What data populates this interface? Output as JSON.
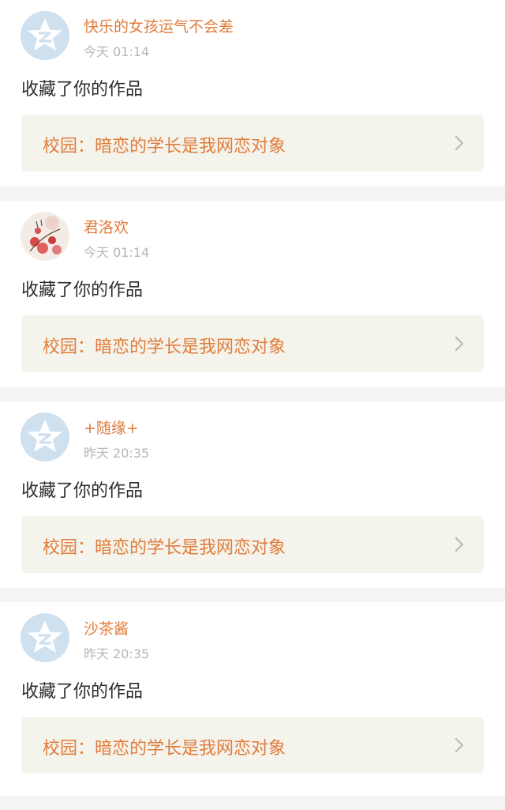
{
  "feed": {
    "items": [
      {
        "user": "快乐的女孩运气不会差",
        "time": "今天 01:14",
        "action": "收藏了你的作品",
        "work_title": "校园：暗恋的学长是我网恋对象",
        "avatar_icon": "default-qzone-star-icon"
      },
      {
        "user": "君洛欢",
        "time": "今天 01:14",
        "action": "收藏了你的作品",
        "work_title": "校园：暗恋的学长是我网恋对象",
        "avatar_icon": "photo-avatar"
      },
      {
        "user": "+随缘+",
        "time": "昨天 20:35",
        "action": "收藏了你的作品",
        "work_title": "校园：暗恋的学长是我网恋对象",
        "avatar_icon": "default-qzone-star-icon"
      },
      {
        "user": "沙茶酱",
        "time": "昨天 20:35",
        "action": "收藏了你的作品",
        "work_title": "校园：暗恋的学长是我网恋对象",
        "avatar_icon": "default-qzone-star-icon"
      }
    ]
  },
  "colors": {
    "accent": "#e07c3c",
    "card_link_bg": "#f4f4ec",
    "avatar_default_bg": "#cfe0ef",
    "time_text": "#b6b6b6"
  }
}
